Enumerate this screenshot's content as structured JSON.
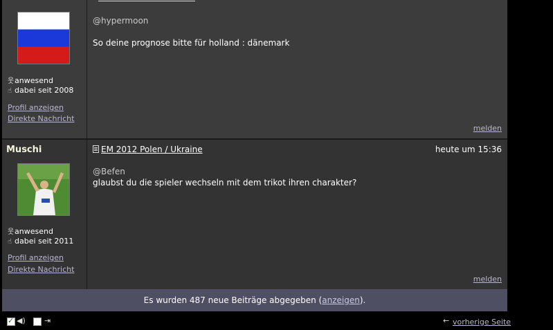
{
  "posts": [
    {
      "username": "",
      "avatar": "russian-flag",
      "status": "anwesend",
      "since": "dabei seit 2008",
      "profile_link": "Profil anzeigen",
      "message_link": "Direkte Nachricht",
      "mention": "@hypermoon",
      "text": "So deine prognose bitte für holland : dänemark",
      "report": "melden"
    },
    {
      "username": "Muschi",
      "avatar": "football-player-photo",
      "status": "anwesend",
      "since": "dabei seit 2011",
      "profile_link": "Profil anzeigen",
      "message_link": "Direkte Nachricht",
      "title": "EM 2012 Polen / Ukraine",
      "time": "heute um 15:36",
      "mention": "@Befen",
      "text": "glaubst du die spieler wechseln mit dem trikot ihren charakter?",
      "report": "melden"
    }
  ],
  "notice": {
    "prefix": "Es wurden 487 neue Beiträge abgegeben (",
    "link": "anzeigen",
    "suffix": ")."
  },
  "footer": {
    "prev_link": "vorherige Seite"
  }
}
